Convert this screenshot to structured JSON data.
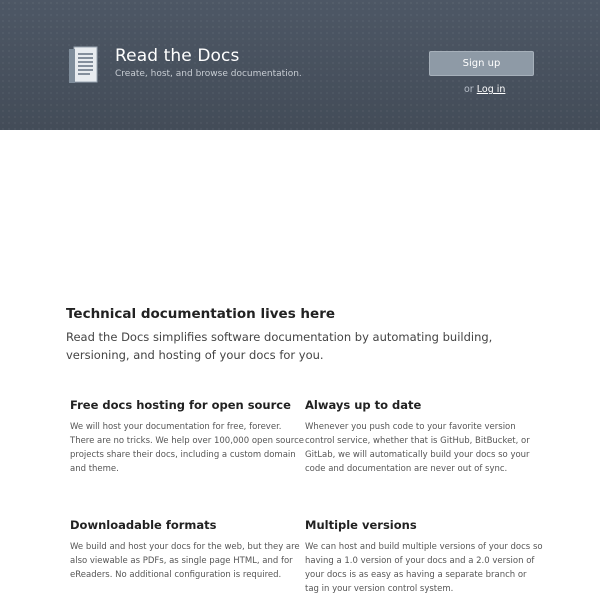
{
  "header": {
    "brand_title": "Read the Docs",
    "brand_tagline": "Create, host, and browse documentation.",
    "signup_label": "Sign up",
    "login_prefix": "or",
    "login_label": "Log in"
  },
  "hero": {
    "title": "Technical documentation lives here",
    "description": "Read the Docs simplifies software documentation by automating building, versioning, and hosting of your docs for you."
  },
  "features": [
    {
      "title": "Free docs hosting for open source",
      "text": "We will host your documentation for free, forever. There are no tricks. We help over 100,000 open source projects share their docs, including a custom domain and theme."
    },
    {
      "title": "Always up to date",
      "text": "Whenever you push code to your favorite version control service, whether that is GitHub, BitBucket, or GitLab, we will automatically build your docs so your code and documentation are never out of sync."
    },
    {
      "title": "Downloadable formats",
      "text": "We build and host your docs for the web, but they are also viewable as PDFs, as single page HTML, and for eReaders. No additional configuration is required."
    },
    {
      "title": "Multiple versions",
      "text": "We can host and build multiple versions of your docs so having a 1.0 version of your docs and a 2.0 version of your docs is as easy as having a separate branch or tag in your version control system."
    }
  ],
  "colors": {
    "header_bg": "#4b5562",
    "signup_bg": "#8e9aa6"
  }
}
